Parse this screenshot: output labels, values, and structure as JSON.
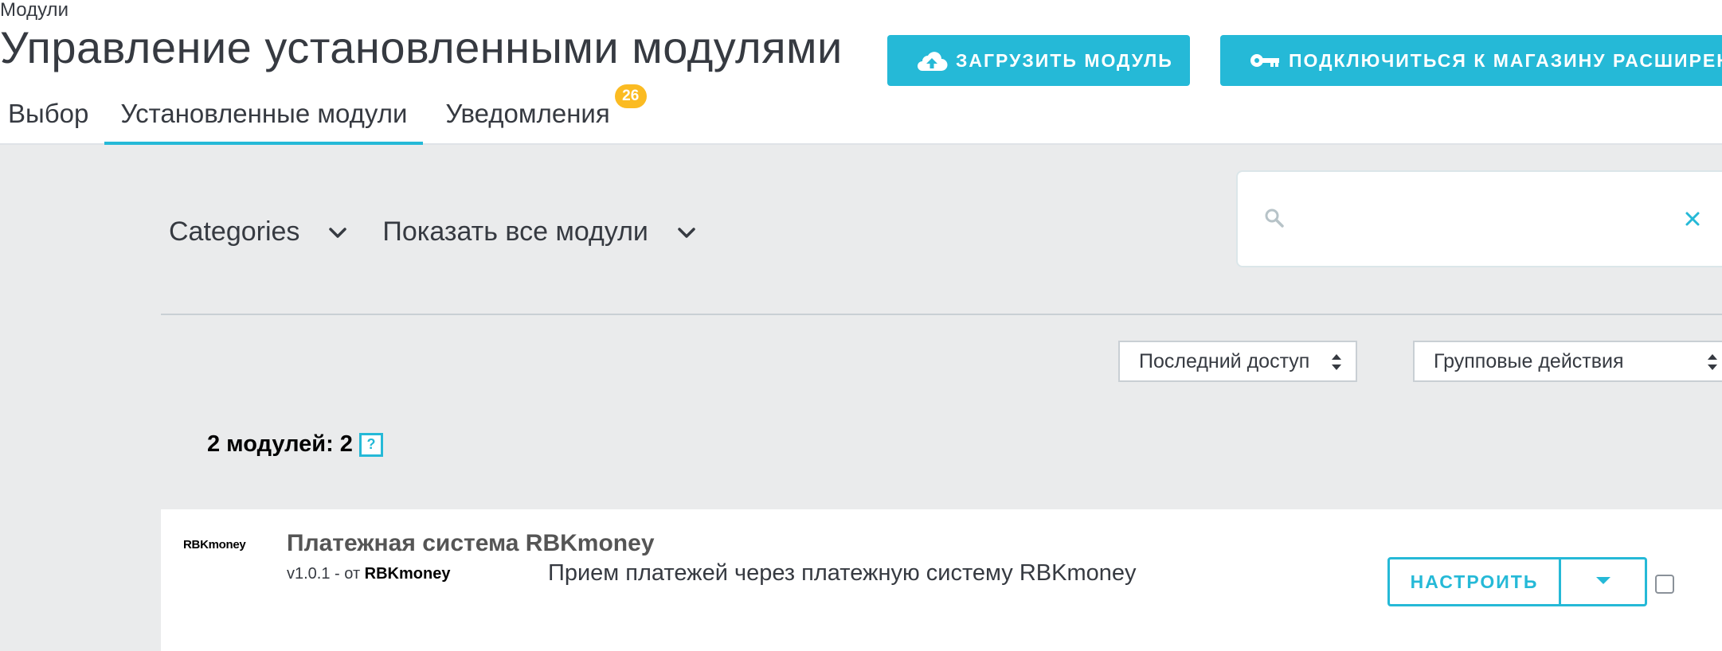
{
  "breadcrumb": "Модули",
  "page_title": "Управление установленными модулями",
  "toolbar": {
    "upload_label": "Загрузить модуль",
    "connect_label": "Подключиться к магазину расширений",
    "upload_icon": "cloud-upload-icon",
    "connect_icon": "key-icon"
  },
  "tabs": [
    {
      "label": "Выбор",
      "active": false
    },
    {
      "label": "Установленные модули",
      "active": true
    },
    {
      "label": "Уведомления",
      "active": false,
      "badge": "26"
    }
  ],
  "filters": {
    "categories_label": "Categories",
    "status_label": "Показать все модули"
  },
  "search": {
    "placeholder": "",
    "value": ""
  },
  "sort": {
    "selected": "Последний доступ"
  },
  "bulk_actions": {
    "selected": "Групповые действия"
  },
  "module_count": {
    "label": "2 модулей: 2",
    "help": "?"
  },
  "modules": [
    {
      "logo_text": "RBKmoney",
      "name": "Платежная система RBKmoney",
      "version_prefix": "v1.0.1 - от",
      "author": "RBKmoney",
      "description": "Прием платежей через платежную систему RBKmoney",
      "configure_label": "НАСТРОИТЬ"
    }
  ],
  "colors": {
    "accent": "#25b9d7",
    "badge": "#fbbb22",
    "background": "#eaebec",
    "text": "#363a41"
  }
}
